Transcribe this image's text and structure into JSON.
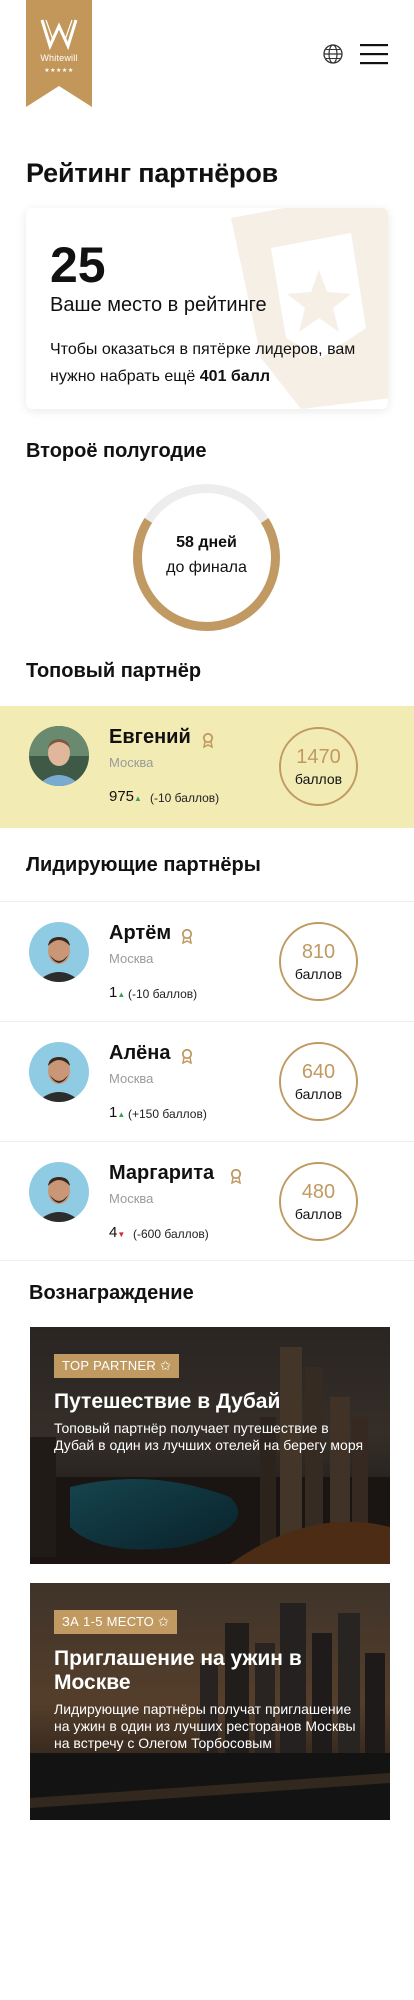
{
  "brand": {
    "name": "Whitewill",
    "stars": "★★★★★",
    "color": "#c3965a"
  },
  "header": {
    "globe_icon": "globe-icon",
    "menu_icon": "hamburger-menu-icon"
  },
  "page_title": "Рейтинг партнёров",
  "rank": {
    "place": "25",
    "caption": "Ваше место в рейтинге",
    "text_before": "Чтобы оказаться в пятёрке лидеров, вам нужно набрать ещё",
    "points_needed": "401 балл"
  },
  "period": {
    "title": "Второё полугодие",
    "days_left": "58 дней",
    "days_caption": "до финала",
    "progress_fraction": 0.68
  },
  "top_partner": {
    "title": "Топовый партнёр",
    "name": "Евгений",
    "city": "Москва",
    "position": "975",
    "trend": "up",
    "delta": "(-10 баллов)",
    "score": "1470",
    "score_label": "баллов"
  },
  "leaders": {
    "title": "Лидирующие партнёры",
    "items": [
      {
        "name": "Артём",
        "city": "Москва",
        "position": "1",
        "trend": "up",
        "delta": "(-10 баллов)",
        "score": "810",
        "score_label": "баллов"
      },
      {
        "name": "Алёна",
        "city": "Москва",
        "position": "1",
        "trend": "up",
        "delta": "(+150 баллов)",
        "score": "640",
        "score_label": "баллов"
      },
      {
        "name": "Маргарита",
        "city": "Москва",
        "position": "4",
        "trend": "down",
        "delta": "(-600 баллов)",
        "score": "480",
        "score_label": "баллов"
      }
    ]
  },
  "rewards": {
    "title": "Вознаграждение",
    "items": [
      {
        "tag": "TOP PARTNER ✩",
        "title": "Путешествие в Дубай",
        "desc": "Топовый партнёр получает путешествие в Дубай в один из лучших отелей на берегу моря"
      },
      {
        "tag": "ЗА 1-5 МЕСТО ✩",
        "title": "Приглашение на ужин в Москве",
        "desc": "Лидирующие партнёры получат приглашение на ужин в один из лучших ресторанов Москвы на встречу с Олегом Торбосовым"
      }
    ]
  },
  "colors": {
    "accent": "#c09a62",
    "highlight_bg": "#f2ecb4",
    "up": "#3aa35a",
    "down": "#d12e2e"
  }
}
